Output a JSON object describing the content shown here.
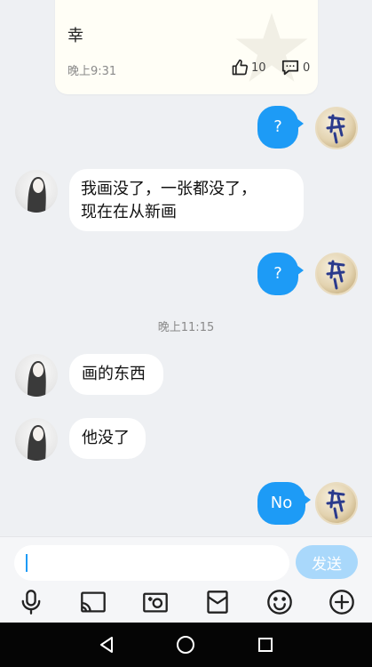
{
  "card": {
    "text": "幸",
    "time": "晚上9:31",
    "likes": "10",
    "comments": "0"
  },
  "messages": [
    {
      "side": "right",
      "text": "?"
    },
    {
      "side": "left",
      "text": "我画没了，一张都没了，",
      "text2": "现在在从新画"
    },
    {
      "side": "right",
      "text": "?"
    },
    {
      "side": "left",
      "text": "画的东西"
    },
    {
      "side": "left",
      "text": "他没了"
    },
    {
      "side": "right",
      "text": "No"
    }
  ],
  "timestamp": "晚上11:15",
  "input": {
    "value": "",
    "send_label": "发送"
  },
  "toolbar": {
    "icons": [
      "microphone-icon",
      "screen-cast-icon",
      "camera-icon",
      "red-packet-icon",
      "emoji-icon",
      "add-icon"
    ]
  },
  "colors": {
    "my_bubble": "#1d9bf6",
    "friend_bubble": "#ffffff",
    "chat_background": "#eef0f3",
    "send_button": "#a9d8fb"
  }
}
